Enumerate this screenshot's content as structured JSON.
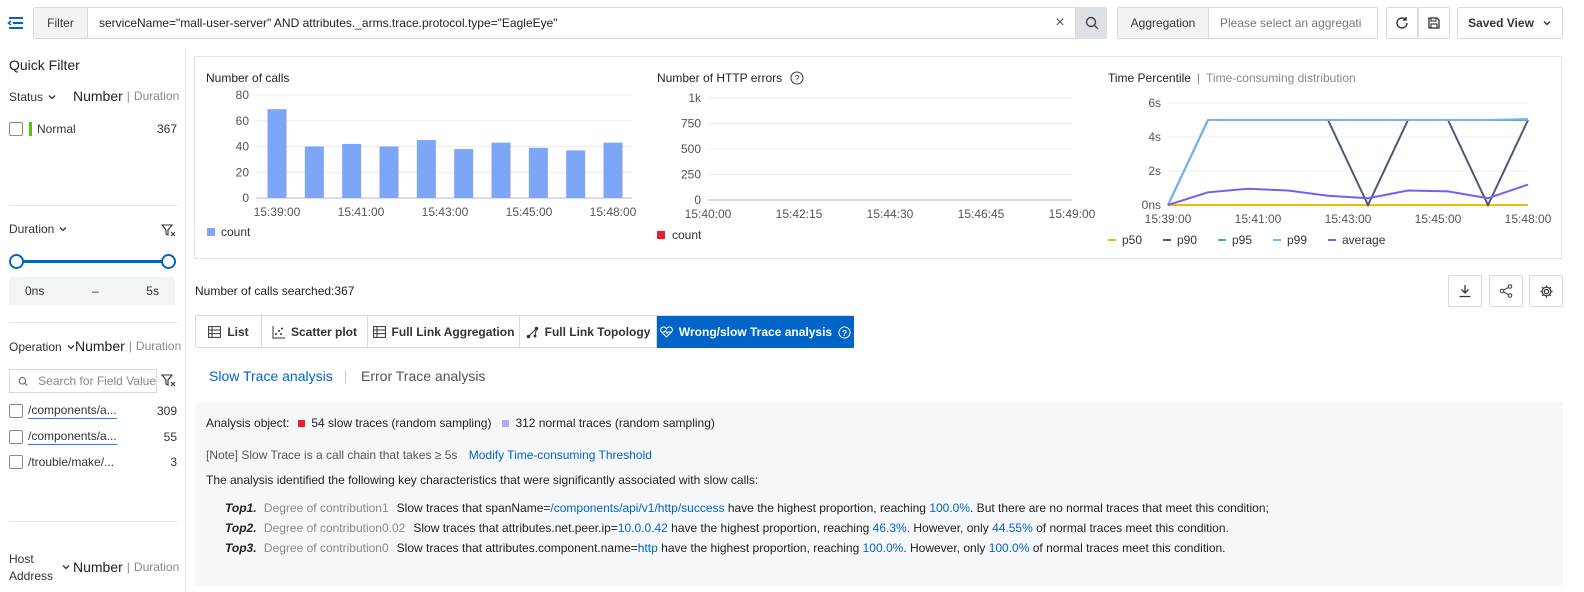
{
  "toolbar": {
    "filter_label": "Filter",
    "filter_query": "serviceName=\"mall-user-server\" AND attributes._arms.trace.protocol.type=\"EagleEye\"",
    "clear_glyph": "×",
    "aggregation_label": "Aggregation",
    "aggregation_placeholder": "Please select an aggregati",
    "saved_view_label": "Saved View"
  },
  "sidebar": {
    "title": "Quick Filter",
    "status": {
      "label": "Status",
      "number": "Number",
      "duration": "Duration",
      "items": [
        {
          "label": "Normal",
          "count": "367",
          "color": "#52c41a"
        }
      ]
    },
    "duration": {
      "label": "Duration",
      "min": "0ns",
      "dash": "–",
      "max": "5s"
    },
    "operation": {
      "label": "Operation",
      "number": "Number",
      "duration": "Duration",
      "search_placeholder": "Search for Field Value",
      "items": [
        {
          "label": "/components/a...",
          "count": "309"
        },
        {
          "label": "/components/a...",
          "count": "55"
        },
        {
          "label": "/trouble/make/...",
          "count": "3"
        }
      ]
    },
    "host": {
      "label_line1": "Host",
      "label_line2": "Address",
      "number": "Number",
      "duration": "Duration"
    }
  },
  "charts": {
    "calls": {
      "title": "Number of calls",
      "legend": "count"
    },
    "errors": {
      "title": "Number of HTTP errors",
      "legend": "count"
    },
    "percentile": {
      "title": "Time Percentile",
      "sep": "|",
      "alt_tab": "Time-consuming distribution"
    }
  },
  "results": {
    "summary": "Number of calls searched:367",
    "tabs": {
      "list": "List",
      "scatter": "Scatter plot",
      "aggregation": "Full Link Aggregation",
      "topology": "Full Link Topology",
      "wrong_slow": "Wrong/slow Trace analysis"
    },
    "subtabs": {
      "slow": "Slow Trace analysis",
      "error": "Error Trace analysis"
    }
  },
  "analysis": {
    "object_label": "Analysis object:",
    "slow_legend": "54 slow traces (random sampling)",
    "normal_legend": "312 normal traces (random sampling)",
    "note": "[Note] Slow Trace is a call chain that takes ≥ 5s",
    "modify_link": "Modify Time-consuming Threshold",
    "intro": "The analysis identified the following key characteristics that were significantly associated with slow calls:",
    "tops": [
      {
        "rank": "Top1.",
        "contribution": "Degree of contribution1",
        "pre": "Slow traces that spanName=",
        "value": "/components/api/v1/http/success",
        "mid": " have the highest proportion, reaching ",
        "pct": "100.0%",
        "post": ". But there are no normal traces that meet this condition;",
        "normal_pct": "",
        "tail": ""
      },
      {
        "rank": "Top2.",
        "contribution": "Degree of contribution0.02",
        "pre": "Slow traces that attributes.net.peer.ip=",
        "value": "10.0.0.42",
        "mid": " have the highest proportion, reaching ",
        "pct": "46.3%",
        "post": ". However, only ",
        "normal_pct": "44.55%",
        "tail": " of normal traces meet this condition."
      },
      {
        "rank": "Top3.",
        "contribution": "Degree of contribution0",
        "pre": "Slow traces that attributes.component.name=",
        "value": "http",
        "mid": " have the highest proportion, reaching ",
        "pct": "100.0%",
        "post": ". However, only ",
        "normal_pct": "100.0%",
        "tail": " of normal traces meet this condition."
      }
    ]
  },
  "chart_data": [
    {
      "type": "bar",
      "title": "Number of calls",
      "categories": [
        "15:39:00",
        "15:40:00",
        "15:41:00",
        "15:42:00",
        "15:43:00",
        "15:44:00",
        "15:45:00",
        "15:46:00",
        "15:47:00",
        "15:48:00"
      ],
      "x_tick_labels": [
        "15:39:00",
        "15:41:00",
        "15:43:00",
        "15:45:00",
        "15:48:00"
      ],
      "series": [
        {
          "name": "count",
          "values": [
            69,
            40,
            42,
            40,
            45,
            38,
            43,
            39,
            37,
            43
          ],
          "color": "#7ea6f6"
        }
      ],
      "yticks": [
        "0",
        "20",
        "40",
        "60",
        "80"
      ],
      "ylim": [
        0,
        80
      ],
      "grid": true,
      "legend": "bottom-left"
    },
    {
      "type": "bar",
      "title": "Number of HTTP errors",
      "x_tick_labels": [
        "15:40:00",
        "15:42:15",
        "15:44:30",
        "15:46:45",
        "15:49:00"
      ],
      "series": [
        {
          "name": "count",
          "values": [],
          "color": "#e8202a"
        }
      ],
      "yticks": [
        "0",
        "250",
        "500",
        "750",
        "1k"
      ],
      "ylim": [
        0,
        1000
      ],
      "grid": true,
      "legend": "bottom-left"
    },
    {
      "type": "line",
      "title": "Time Percentile",
      "x": [
        "15:39:00",
        "15:40:00",
        "15:41:00",
        "15:42:00",
        "15:43:00",
        "15:44:00",
        "15:45:00",
        "15:46:00",
        "15:47:00",
        "15:48:00"
      ],
      "x_tick_labels": [
        "15:39:00",
        "15:41:00",
        "15:43:00",
        "15:45:00",
        "15:48:00"
      ],
      "yticks": [
        "0ns",
        "2s",
        "4s",
        "6s"
      ],
      "ylim": [
        0,
        6
      ],
      "series": [
        {
          "name": "p50",
          "color": "#f5b800",
          "values": [
            0,
            0,
            0,
            0,
            0,
            0,
            0,
            0,
            0,
            0
          ]
        },
        {
          "name": "p90",
          "color": "#4a5a7a",
          "values": [
            0,
            5,
            5,
            5,
            5,
            0,
            5,
            5,
            0,
            5
          ]
        },
        {
          "name": "p95",
          "color": "#36b9a0",
          "values": [
            0,
            5,
            5,
            5,
            5,
            5,
            5,
            5,
            5,
            5
          ]
        },
        {
          "name": "p99",
          "color": "#7ab0f5",
          "values": [
            0,
            5,
            5,
            5,
            5,
            5,
            5,
            5,
            5,
            5.05
          ]
        },
        {
          "name": "average",
          "color": "#7b5cf0",
          "values": [
            0,
            0.75,
            0.95,
            0.85,
            0.55,
            0.4,
            0.85,
            0.8,
            0.4,
            1.2
          ]
        }
      ],
      "grid": true,
      "legend": "bottom"
    }
  ],
  "colors": {
    "accent": "#0064c8",
    "slow": "#e8202a",
    "normal": "#b4a6f0"
  }
}
